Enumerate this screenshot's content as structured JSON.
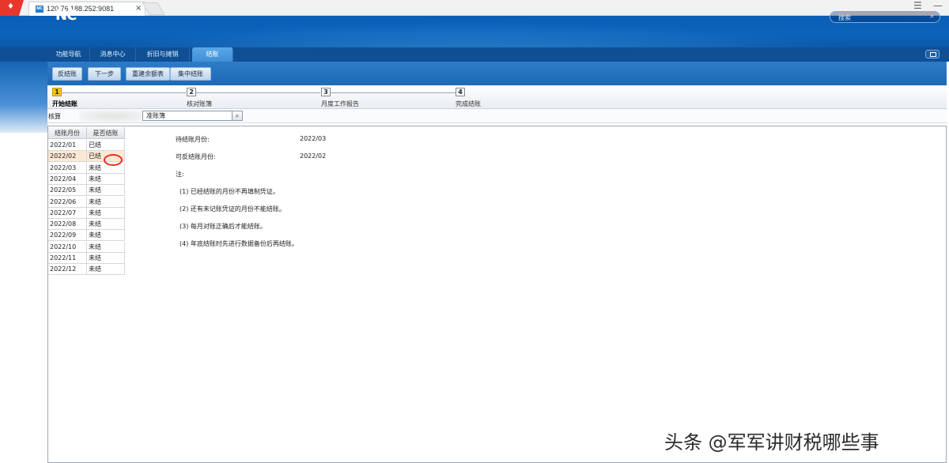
{
  "browser": {
    "tab_title": "120.76.188.252:9081",
    "favicon_text": "NC",
    "tab_close": "×"
  },
  "header": {
    "logo": "NC",
    "search_placeholder": "搜索"
  },
  "nav_tabs": [
    {
      "label": "功能导航"
    },
    {
      "label": "消息中心"
    },
    {
      "label": "折旧与摊销"
    },
    {
      "label": "结账"
    }
  ],
  "toolbar": {
    "buttons": [
      {
        "label": "反结账"
      },
      {
        "label": "下一步"
      },
      {
        "label": "重建余额表"
      },
      {
        "label": "集中结账"
      }
    ]
  },
  "steps": [
    {
      "number": "1",
      "label": "开始结账",
      "active": true
    },
    {
      "number": "2",
      "label": "核对账簿",
      "active": false
    },
    {
      "number": "3",
      "label": "月度工作报告",
      "active": false
    },
    {
      "number": "4",
      "label": "完成结账",
      "active": false
    }
  ],
  "filter": {
    "label": "核算",
    "input_value": "准账簿"
  },
  "grid": {
    "headers": [
      "结账月份",
      "是否结账"
    ],
    "rows": [
      {
        "month": "2022/01",
        "status": "已结"
      },
      {
        "month": "2022/02",
        "status": "已结"
      },
      {
        "month": "2022/03",
        "status": "未结"
      },
      {
        "month": "2022/04",
        "status": "未结"
      },
      {
        "month": "2022/05",
        "status": "未结"
      },
      {
        "month": "2022/06",
        "status": "未结"
      },
      {
        "month": "2022/07",
        "status": "未结"
      },
      {
        "month": "2022/08",
        "status": "未结"
      },
      {
        "month": "2022/09",
        "status": "未结"
      },
      {
        "month": "2022/10",
        "status": "未结"
      },
      {
        "month": "2022/11",
        "status": "未结"
      },
      {
        "month": "2022/12",
        "status": "未结"
      }
    ],
    "selected_index": 1
  },
  "info": {
    "pending_label": "待结账月份:",
    "pending_value": "2022/03",
    "reversible_label": "可反结账月份:",
    "reversible_value": "2022/02",
    "note_title": "注:",
    "notes": [
      "(1) 已经结账的月份不再填制凭证。",
      "(2) 还有未记账凭证的月份不能结账。",
      "(3) 每月对账正确后才能结账。",
      "(4) 年底结账时先进行数据备份后再结账。"
    ]
  },
  "watermark": "头条 @军军讲财税哪些事",
  "colors": {
    "header_blue": "#0c63ba",
    "nav_blue": "#0e4f96",
    "step_active": "#f6c11c",
    "selected_row": "#fde9d3",
    "marker_red": "#e0301e"
  }
}
